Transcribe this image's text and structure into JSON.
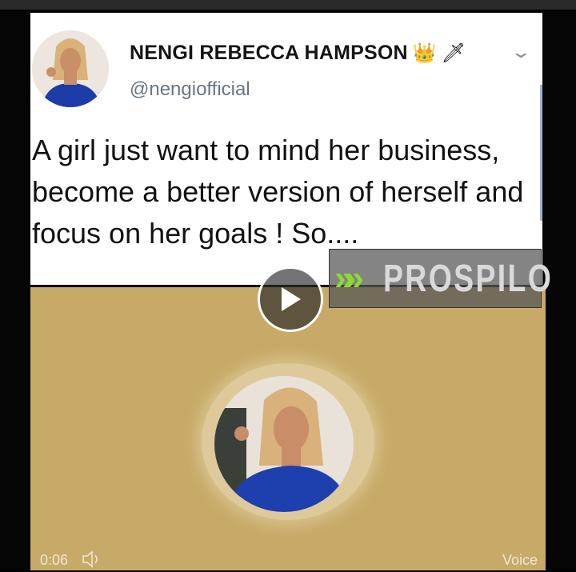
{
  "tweet": {
    "display_name": "NENGI REBECCA HAMPSON",
    "name_emojis": [
      "👑",
      "🗡"
    ],
    "handle": "@nengiofficial",
    "text": "A girl just want to mind her business, become a better version of herself and focus on her goals ! So...."
  },
  "watermark": {
    "arrows": "»»",
    "brand": "PROSPILO",
    "accent_color": "#8edb2f"
  },
  "player": {
    "elapsed": "0:06",
    "label": "Voice",
    "background_color": "#c7aa68",
    "icons": [
      "play-icon",
      "speaker-icon"
    ]
  }
}
